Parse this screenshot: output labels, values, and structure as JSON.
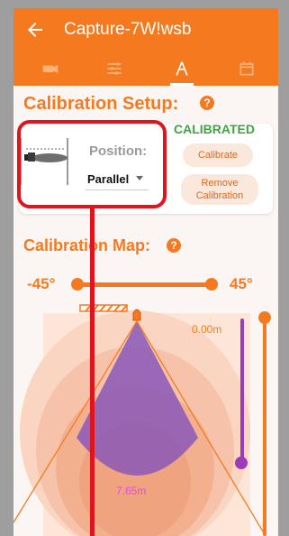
{
  "app": {
    "title": "Capture-7W!wsb",
    "back_icon": "back-arrow-icon"
  },
  "tabs": [
    {
      "icon": "camera-tab-icon"
    },
    {
      "icon": "sliders-tab-icon"
    },
    {
      "icon": "calibration-tab-icon",
      "active": true
    },
    {
      "icon": "calendar-tab-icon"
    }
  ],
  "calibration_setup": {
    "title": "Calibration Setup:",
    "help": "?",
    "position_label": "Position:",
    "position_value": "Parallel",
    "status": "CALIBRATED",
    "calibrate_button": "Calibrate",
    "remove_button_line1": "Remove",
    "remove_button_line2": "Calibration"
  },
  "calibration_map": {
    "title": "Calibration Map:",
    "help": "?",
    "angle_min": "-45°",
    "angle_max": "45°",
    "distance_near": "0.00m",
    "distance_far": "7.65m"
  },
  "colors": {
    "accent": "#f57a1f",
    "status_green": "#3fa33f",
    "highlight_red": "#e0141c",
    "cone_purple": "#8a58b9",
    "slider_purple": "#9b3bb5"
  }
}
